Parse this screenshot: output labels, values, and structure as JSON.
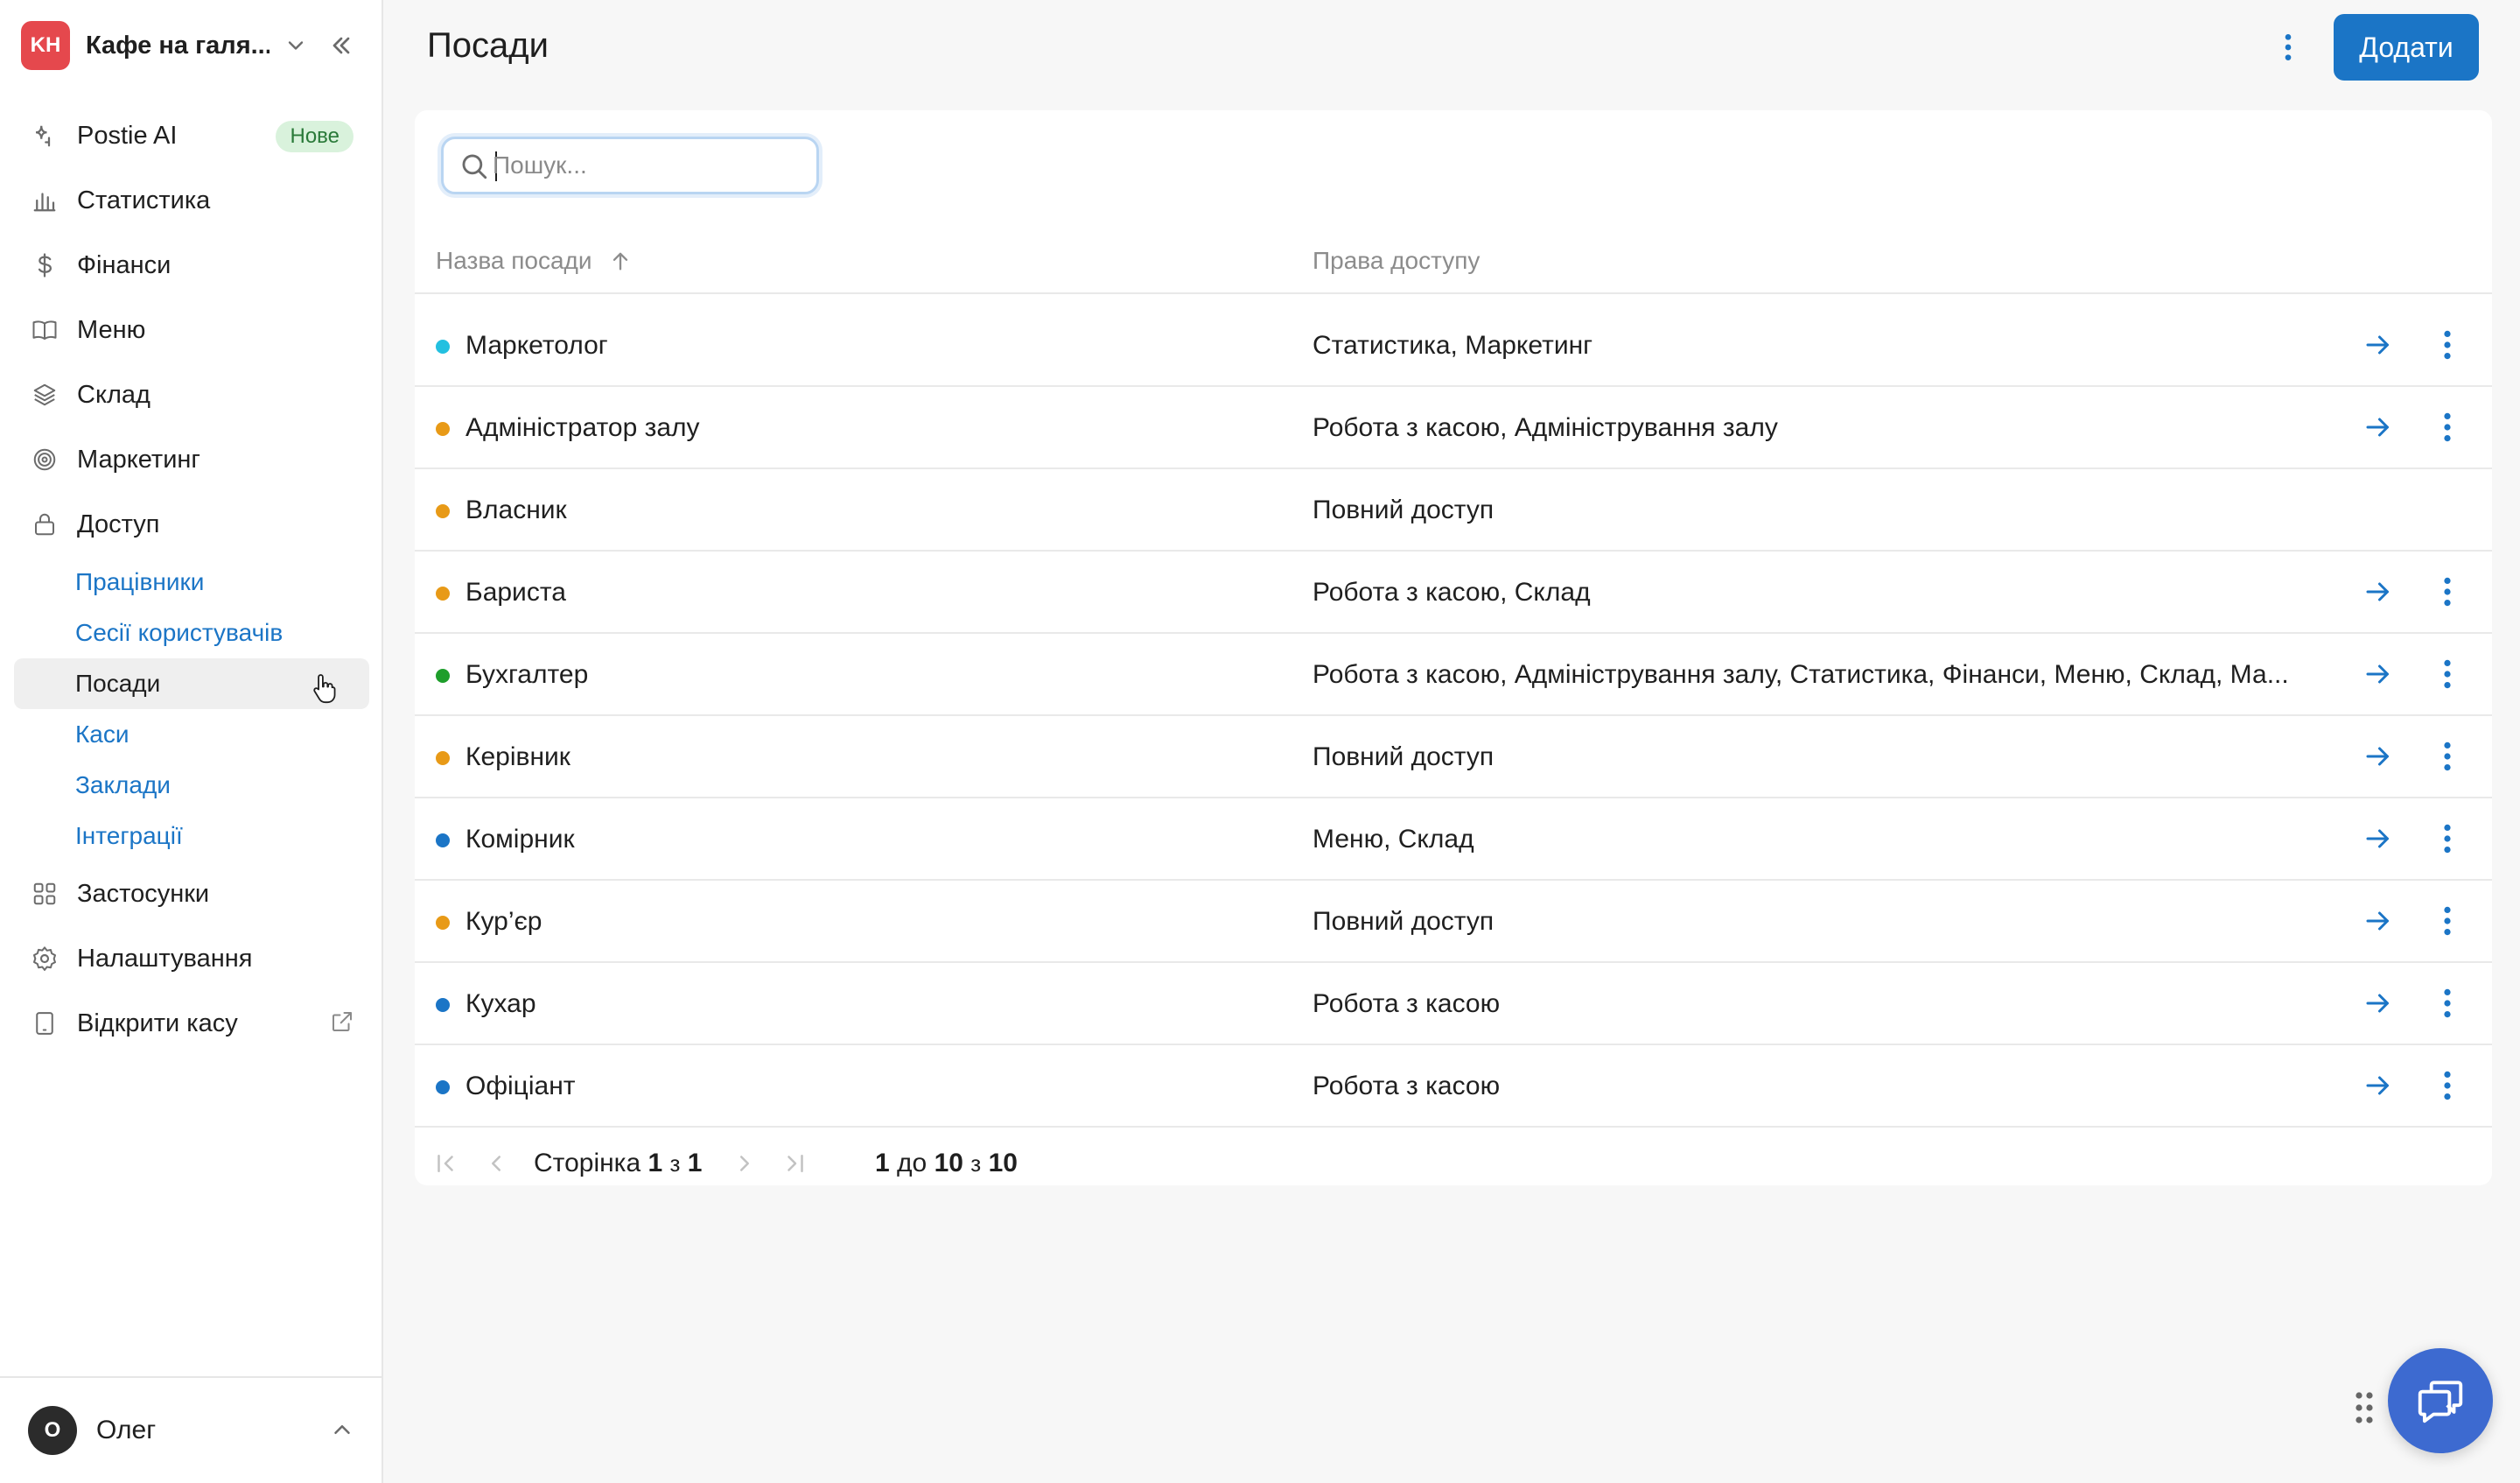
{
  "org": {
    "initials": "KH",
    "name": "Кафе на галя..."
  },
  "sidebar": {
    "items": [
      {
        "label": "Postie AI",
        "icon": "sparkle-icon",
        "badge": "Нове"
      },
      {
        "label": "Статистика",
        "icon": "bar-chart-icon"
      },
      {
        "label": "Фінанси",
        "icon": "dollar-icon"
      },
      {
        "label": "Меню",
        "icon": "book-icon"
      },
      {
        "label": "Склад",
        "icon": "layers-icon"
      },
      {
        "label": "Маркетинг",
        "icon": "target-icon"
      },
      {
        "label": "Доступ",
        "icon": "lock-icon"
      }
    ],
    "subitems": [
      {
        "label": "Працівники"
      },
      {
        "label": "Сесії користувачів"
      },
      {
        "label": "Посади",
        "active": true
      },
      {
        "label": "Каси"
      },
      {
        "label": "Заклади"
      },
      {
        "label": "Інтеграції"
      }
    ],
    "bottom_items": [
      {
        "label": "Застосунки",
        "icon": "grid-icon"
      },
      {
        "label": "Налаштування",
        "icon": "gear-icon"
      },
      {
        "label": "Відкрити касу",
        "icon": "tablet-icon"
      }
    ]
  },
  "user": {
    "initial": "О",
    "name": "Олег"
  },
  "header": {
    "title": "Посади",
    "add_label": "Додати"
  },
  "search": {
    "placeholder": "Пошук..."
  },
  "table": {
    "columns": {
      "name": "Назва посади",
      "permissions": "Права доступу"
    },
    "rows": [
      {
        "name": "Маркетолог",
        "permissions": "Статистика, Маркетинг",
        "color": "#23c0e0",
        "actions": true
      },
      {
        "name": "Адміністратор залу",
        "permissions": "Робота з касою, Адміністрування залу",
        "color": "#e89a17",
        "actions": true
      },
      {
        "name": "Власник",
        "permissions": "Повний доступ",
        "color": "#e89a17",
        "actions": false
      },
      {
        "name": "Бариста",
        "permissions": "Робота з касою, Склад",
        "color": "#e89a17",
        "actions": true
      },
      {
        "name": "Бухгалтер",
        "permissions": "Робота з касою, Адміністрування залу, Статистика, Фінанси, Меню, Склад, Ма...",
        "color": "#1e9e2b",
        "actions": true
      },
      {
        "name": "Керівник",
        "permissions": "Повний доступ",
        "color": "#e89a17",
        "actions": true
      },
      {
        "name": "Комірник",
        "permissions": "Меню, Склад",
        "color": "#1b75c6",
        "actions": true
      },
      {
        "name": "Кур’єр",
        "permissions": "Повний доступ",
        "color": "#e89a17",
        "actions": true
      },
      {
        "name": "Кухар",
        "permissions": "Робота з касою",
        "color": "#1b75c6",
        "actions": true
      },
      {
        "name": "Офіціант",
        "permissions": "Робота з касою",
        "color": "#1b75c6",
        "actions": true
      }
    ]
  },
  "pager": {
    "page_label": "Сторінка",
    "page": "1",
    "of": "з",
    "total_pages": "1",
    "range_from": "1",
    "range_to_word": "до",
    "range_to": "10",
    "range_of_word": "з",
    "total": "10"
  },
  "colors": {
    "accent": "#1b75c6",
    "chat": "#3d6ad0"
  }
}
